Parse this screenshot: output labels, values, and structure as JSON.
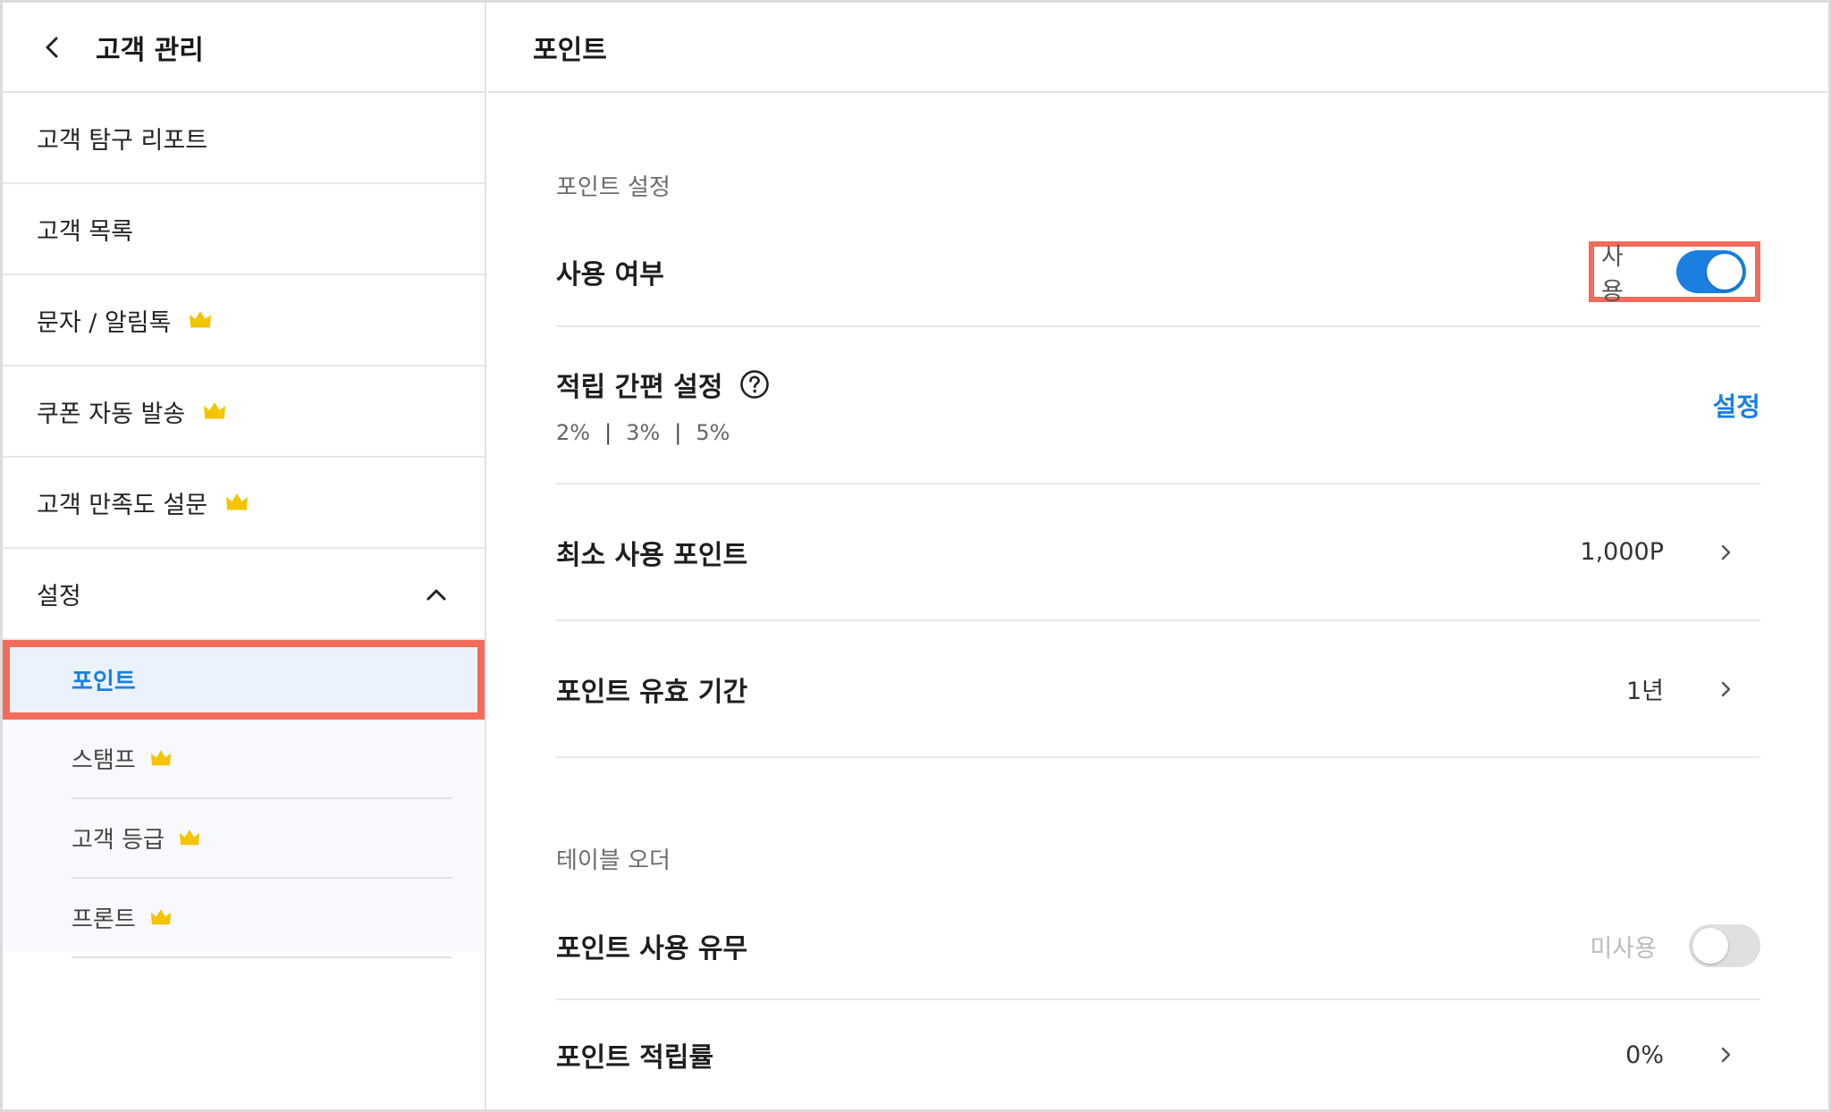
{
  "sidebar": {
    "title": "고객 관리",
    "items": [
      {
        "label": "고객 탐구 리포트",
        "premium": false
      },
      {
        "label": "고객 목록",
        "premium": false
      },
      {
        "label": "문자 / 알림톡",
        "premium": true
      },
      {
        "label": "쿠폰 자동 발송",
        "premium": true
      },
      {
        "label": "고객 만족도 설문",
        "premium": true
      }
    ],
    "settings": {
      "label": "설정",
      "expanded": true,
      "sub_items": [
        {
          "label": "포인트",
          "active": true,
          "premium": false
        },
        {
          "label": "스탬프",
          "active": false,
          "premium": true
        },
        {
          "label": "고객 등급",
          "active": false,
          "premium": true
        },
        {
          "label": "프론트",
          "active": false,
          "premium": true
        }
      ]
    }
  },
  "main": {
    "title": "포인트",
    "point_settings": {
      "section_title": "포인트 설정",
      "usage": {
        "label": "사용 여부",
        "state_text": "사용",
        "enabled": true
      },
      "quick_accrual": {
        "label": "적립 간편 설정",
        "rates": [
          "2%",
          "3%",
          "5%"
        ],
        "action_label": "설정"
      },
      "min_usage": {
        "label": "최소 사용 포인트",
        "value": "1,000P"
      },
      "validity": {
        "label": "포인트 유효 기간",
        "value": "1년"
      }
    },
    "table_order": {
      "section_title": "테이블 오더",
      "point_usage": {
        "label": "포인트 사용 유무",
        "state_text": "미사용",
        "enabled": false
      },
      "accrual_rate": {
        "label": "포인트 적립률",
        "value": "0%"
      }
    }
  },
  "colors": {
    "accent": "#1a7fe0",
    "highlight": "#f26b5b",
    "crown": "#f5c400"
  },
  "icons": [
    "back-chevron-icon",
    "crown-icon",
    "chevron-up-icon",
    "chevron-right-icon",
    "help-icon"
  ]
}
